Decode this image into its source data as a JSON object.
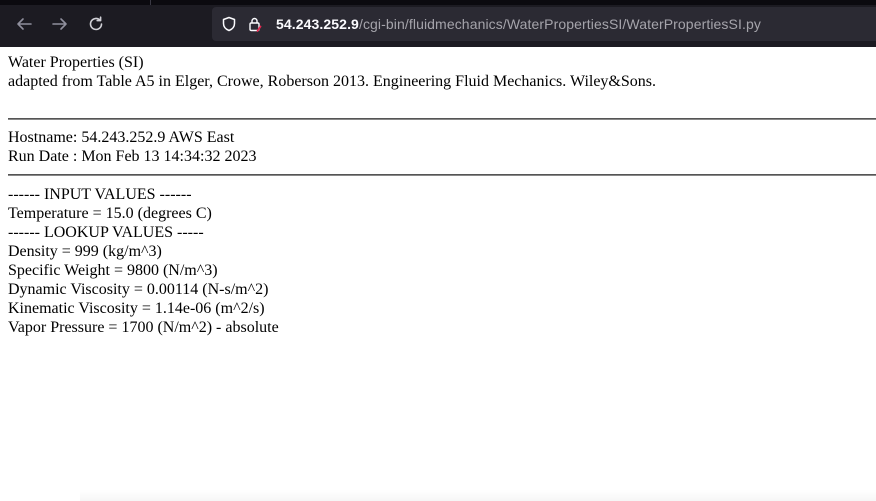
{
  "browser": {
    "url_host": "54.243.252.9",
    "url_path": "/cgi-bin/fluidmechanics/WaterPropertiesSI/WaterPropertiesSI.py",
    "icons": [
      "back-arrow-icon",
      "forward-arrow-icon",
      "reload-icon",
      "shield-icon",
      "lock-warning-icon"
    ]
  },
  "page": {
    "title": "Water Properties (SI)",
    "source": "adapted from Table A5 in Elger, Crowe, Roberson 2013. Engineering Fluid Mechanics. Wiley&Sons.",
    "hostname": "Hostname: 54.243.252.9 AWS East",
    "run_date": "Run Date : Mon Feb 13 14:34:32 2023",
    "input_header": "------ INPUT VALUES ------",
    "temperature": "Temperature = 15.0 (degrees C)",
    "lookup_header": "------ LOOKUP VALUES -----",
    "density": "Density = 999 (kg/m^3)",
    "specific_weight": "Specific Weight = 9800 (N/m^3)",
    "dynamic_viscosity": "Dynamic Viscosity = 0.00114 (N-s/m^2)",
    "kinematic_viscosity": "Kinematic Viscosity = 1.14e-06 (m^2/s)",
    "vapor_pressure": "Vapor Pressure = 1700 (N/m^2) - absolute"
  }
}
